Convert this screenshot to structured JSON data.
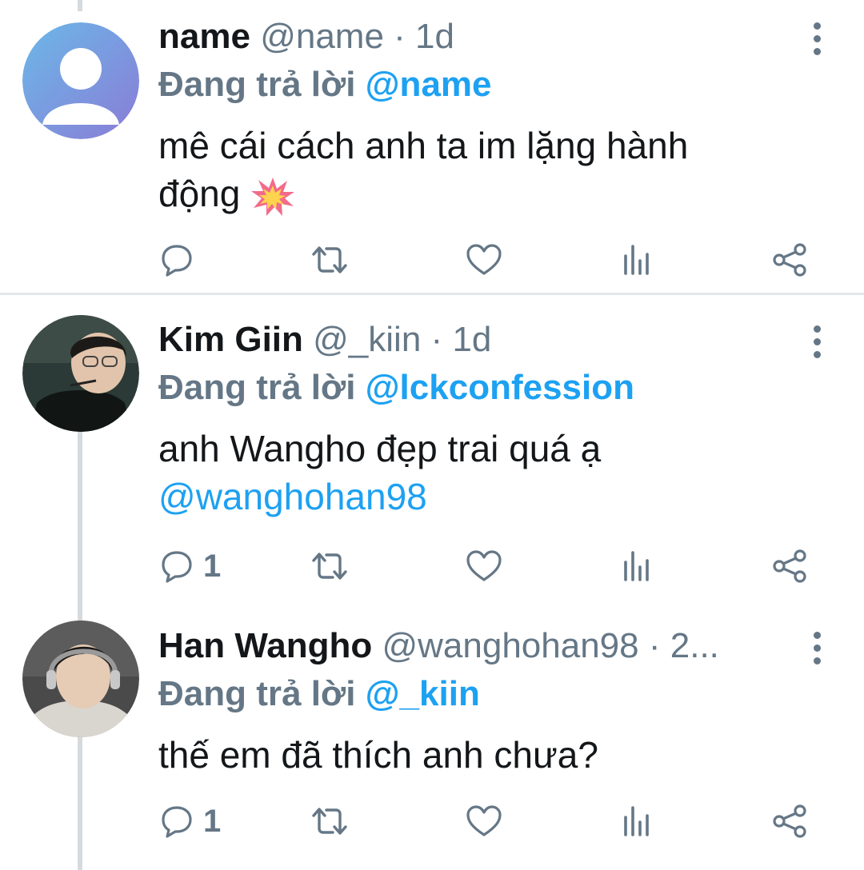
{
  "tweets": [
    {
      "name": "name",
      "handle": "@name",
      "time": "1d",
      "replying_prefix": "Đang trả lời ",
      "replying_to": "@name",
      "text": "mê cái cách anh ta im lặng hành động",
      "emoji": "collision-emoji",
      "reply_count": "",
      "avatar": "default-avatar",
      "avatar_colors": [
        "#6bb8e8",
        "#8a7cd6"
      ]
    },
    {
      "name": "Kim Giin",
      "handle": "@_kiin",
      "time": "1d",
      "replying_prefix": "Đang trả lời ",
      "replying_to": "@lckconfession",
      "text": "anh Wangho đẹp trai quá ạ",
      "mention": "@wanghohan98",
      "reply_count": "1",
      "avatar": "photo-avatar"
    },
    {
      "name": "Han Wangho",
      "handle": "@wanghohan98",
      "time": "2...",
      "replying_prefix": "Đang trả lời ",
      "replying_to": "@_kiin",
      "text": "thế em đã thích anh chưa?",
      "reply_count": "1",
      "avatar": "photo-avatar"
    }
  ],
  "action_icons": [
    "reply-icon",
    "retweet-icon",
    "like-icon",
    "analytics-icon",
    "share-icon"
  ],
  "colors": {
    "text": "#14171a",
    "secondary": "#657786",
    "accent": "#1da1f2",
    "thread_line": "#d5dade"
  }
}
